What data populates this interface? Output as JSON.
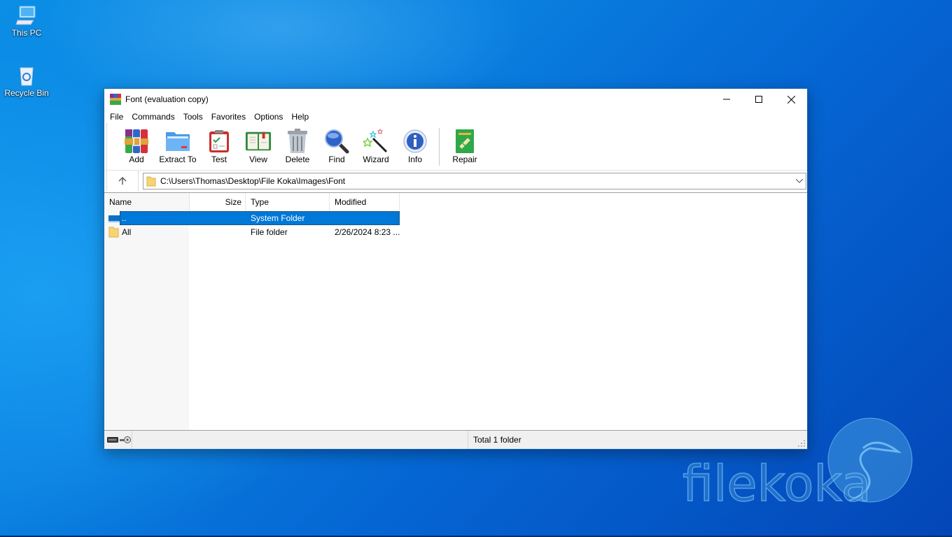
{
  "desktop": {
    "icons": [
      {
        "label": "This PC",
        "icon": "computer-icon"
      },
      {
        "label": "Recycle Bin",
        "icon": "recycle-bin-icon"
      }
    ],
    "watermark": "filekoka"
  },
  "window": {
    "title": "Font (evaluation copy)",
    "app_icon": "winrar-icon",
    "controls": {
      "minimize": "minimize-icon",
      "maximize": "maximize-icon",
      "close": "close-icon"
    }
  },
  "menu": [
    "File",
    "Commands",
    "Tools",
    "Favorites",
    "Options",
    "Help"
  ],
  "toolbar": {
    "buttons": [
      {
        "label": "Add",
        "icon": "add-archive-icon"
      },
      {
        "label": "Extract To",
        "icon": "extract-folder-icon"
      },
      {
        "label": "Test",
        "icon": "test-clipboard-icon"
      },
      {
        "label": "View",
        "icon": "view-book-icon"
      },
      {
        "label": "Delete",
        "icon": "trash-icon"
      },
      {
        "label": "Find",
        "icon": "magnifier-icon"
      },
      {
        "label": "Wizard",
        "icon": "magic-wand-icon"
      },
      {
        "label": "Info",
        "icon": "info-icon"
      },
      {
        "label": "Repair",
        "icon": "repair-icon"
      }
    ]
  },
  "address": {
    "path": "C:\\Users\\Thomas\\Desktop\\File Koka\\Images\\Font",
    "up_icon": "up-arrow-icon",
    "dropdown_icon": "chevron-down-icon"
  },
  "file_list": {
    "columns": [
      "Name",
      "Size",
      "Type",
      "Modified"
    ],
    "sort_indicator": "^",
    "rows": [
      {
        "name": "..",
        "size": "",
        "type": "System Folder",
        "modified": "",
        "selected": true
      },
      {
        "name": "All",
        "size": "",
        "type": "File folder",
        "modified": "2/26/2024 8:23 ...",
        "selected": false
      }
    ]
  },
  "status": {
    "text": "Total 1 folder",
    "icons": [
      "drive-icon",
      "key-icon"
    ]
  },
  "colors": {
    "selection": "#0078d7",
    "window_border": "#1b66b3",
    "desktop": "#0a7fe0"
  }
}
